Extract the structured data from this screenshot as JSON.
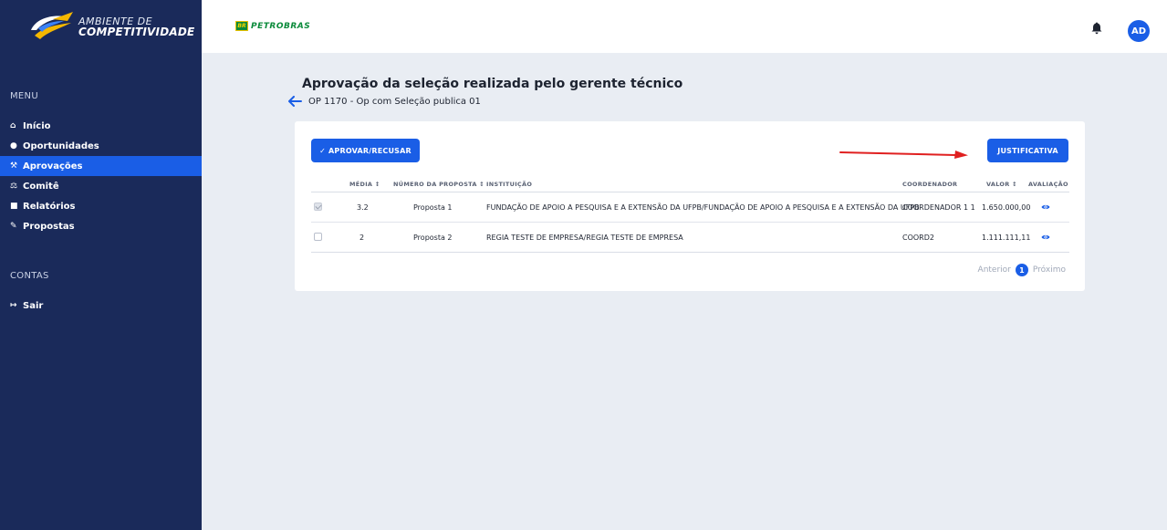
{
  "brand": {
    "line1": "AMBIENTE DE",
    "line2": "COMPETITIVIDADE"
  },
  "topbar": {
    "partner_logo_text": "PETROBRAS",
    "partner_box_text": "BR",
    "avatar_initials": "AD"
  },
  "sidebar": {
    "menu_label": "MENU",
    "items": [
      {
        "label": "Início",
        "icon": "home-icon",
        "glyph": "⌂",
        "active": false
      },
      {
        "label": "Oportunidades",
        "icon": "lightbulb-icon",
        "glyph": "●",
        "active": false
      },
      {
        "label": "Aprovações",
        "icon": "gavel-icon",
        "glyph": "⚒",
        "active": true
      },
      {
        "label": "Comitê",
        "icon": "scale-icon",
        "glyph": "⚖",
        "active": false
      },
      {
        "label": "Relatórios",
        "icon": "file-icon",
        "glyph": "■",
        "active": false
      },
      {
        "label": "Propostas",
        "icon": "file-signature-icon",
        "glyph": "✎",
        "active": false
      }
    ],
    "contas_label": "CONTAS",
    "logout": {
      "label": "Sair",
      "icon": "sign-out-icon",
      "glyph": "↦"
    }
  },
  "page": {
    "title": "Aprovação da seleção realizada pelo gerente técnico",
    "breadcrumb": "OP 1170 - Op com Seleção publica 01"
  },
  "actions": {
    "approve_label": "✓  APROVAR/RECUSAR",
    "justify_label": "JUSTIFICATIVA"
  },
  "table": {
    "headers": {
      "media": "MÉDIA ↕",
      "numero": "NÚMERO DA PROPOSTA ↕",
      "instituicao": "INSTITUIÇÃO",
      "coordenador": "COORDENADOR",
      "valor": "VALOR ↕",
      "avaliacao": "AVALIAÇÃO"
    },
    "rows": [
      {
        "checked": true,
        "media": "3.2",
        "numero": "Proposta 1",
        "instituicao": "FUNDAÇÃO DE APOIO A PESQUISA E A EXTENSÃO DA UFPB/FUNDAÇÃO DE APOIO A PESQUISA E A EXTENSÃO DA UFPB",
        "coordenador": "COORDENADOR 1 1",
        "valor": "1.650.000,00"
      },
      {
        "checked": false,
        "media": "2",
        "numero": "Proposta 2",
        "instituicao": "REGIA TESTE DE EMPRESA/REGIA TESTE DE EMPRESA",
        "coordenador": "COORD2",
        "valor": "1.111.111,11"
      }
    ]
  },
  "pagination": {
    "prev": "Anterior",
    "current": "1",
    "next": "Próximo"
  },
  "colors": {
    "sidebar_bg": "#1a2a5a",
    "accent": "#1a5ee6",
    "annotation_arrow": "#e02020"
  }
}
